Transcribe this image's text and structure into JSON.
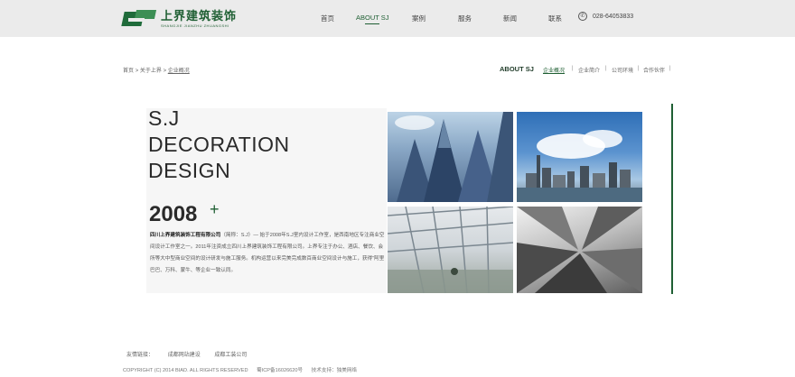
{
  "logo": {
    "cn": "上界建筑装饰",
    "en": "SHANGJIE JIANZHU ZHUANGSHI"
  },
  "nav": {
    "items": [
      "首页",
      "ABOUT SJ",
      "案例",
      "服务",
      "新闻",
      "联系"
    ],
    "active": "ABOUT SJ"
  },
  "phone": "028-64053833",
  "breadcrumb": {
    "home": "首页",
    "sep1": ">",
    "about": "关于上界",
    "sep2": ">",
    "current": "企业概况"
  },
  "section": {
    "title": "ABOUT SJ",
    "subnav": [
      "企业概况",
      "企业简介",
      "公司环境",
      "合作伙伴"
    ],
    "active": "企业概况"
  },
  "main": {
    "title_lines": [
      "S.J",
      "DECORATION",
      "DESIGN"
    ],
    "year": "2008",
    "plus": "+",
    "company_name": "四川上界建筑装饰工程有限公司",
    "desc_rest": "（简称：S.J）— 始于2008年S.J室内设计工作室，是西南地区专注商业空间设计工作室之一。2011年注资成立四川上界建筑装饰工程有限公司。上界专注于办公、酒店、餐饮、会所等大中型商业空间的设计研发与施工服务。机构运营以来完美完成数百商业空间设计与施工，获得“阿里巴巴、万科、蒙牛、等企业一致认同。"
  },
  "photos": {
    "p1": "glass-skyscrapers-icon",
    "p2": "city-skyline-icon",
    "p3": "glass-atrium-icon",
    "p4": "skyscraper-lookup-icon"
  },
  "footer": {
    "links_label": "友情链接：",
    "links": [
      "成都网站建设",
      "成都工装公司"
    ],
    "copyright": "COPYRIGHT (C) 2014 BIAD. ALL RIGHTS RESERVED",
    "icp": "蜀ICP备16026620号",
    "support": "技术支持：独美网络"
  },
  "colors": {
    "accent": "#1f5f33",
    "header_bg": "#ebebeb",
    "panel_bg": "#f6f6f6"
  }
}
